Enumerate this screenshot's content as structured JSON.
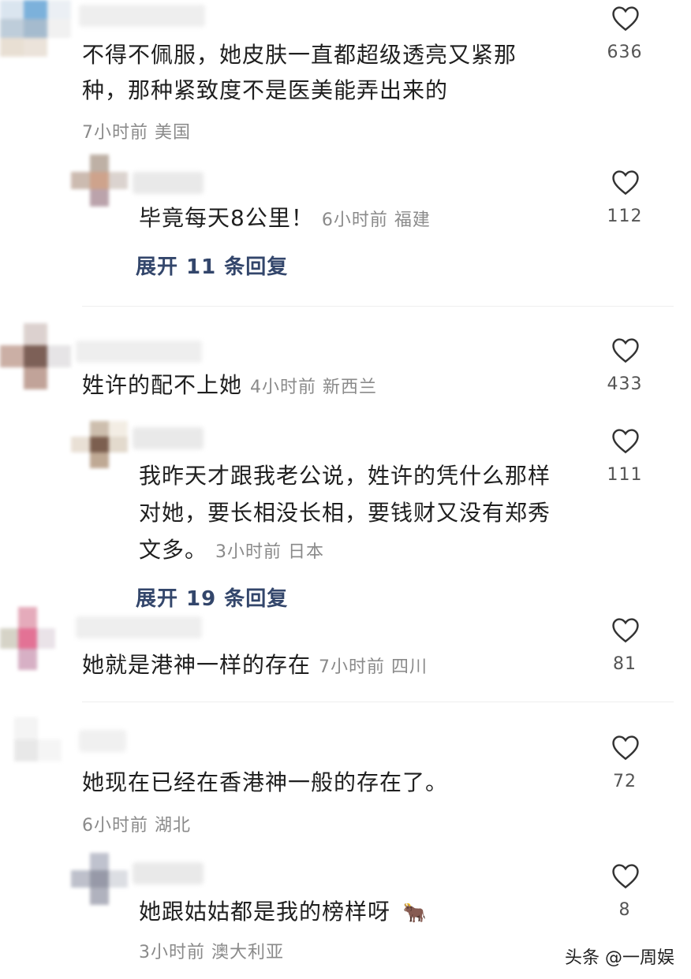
{
  "comments": [
    {
      "text_line1": "不得不佩服，她皮肤一直都超级透亮又紧那",
      "text_line2": "种，那种紧致度不是医美能弄出来的",
      "meta": "7小时前 美国",
      "likes": "636"
    },
    {
      "text": "毕竟每天8公里！",
      "meta": "6小时前 福建",
      "likes": "112",
      "expand": "展开 11 条回复"
    },
    {
      "text": "姓许的配不上她",
      "meta": "4小时前 新西兰",
      "likes": "433"
    },
    {
      "text_line1": "我昨天才跟我老公说，姓许的凭什么那样",
      "text_line2": "对她，要长相没长相，要钱财又没有郑秀",
      "text_line3": "文多。",
      "meta": "3小时前 日本",
      "likes": "111",
      "expand": "展开 19 条回复"
    },
    {
      "text": "她就是港神一样的存在",
      "meta": "7小时前 四川",
      "likes": "81"
    },
    {
      "text": "她现在已经在香港神一般的存在了。",
      "meta": "6小时前 湖北",
      "likes": "72"
    },
    {
      "text": "她跟姑姑都是我的榜样呀",
      "emoji": "🐂",
      "meta": "3小时前 澳大利亚",
      "likes": "8"
    }
  ],
  "watermark": "头条 @一周娱",
  "icons": {
    "like": "heart-outline-icon",
    "emoji": "cow-emoji"
  },
  "colors": {
    "text": "#1f1f1f",
    "meta": "#8a8a8a",
    "expand": "#33466b"
  }
}
